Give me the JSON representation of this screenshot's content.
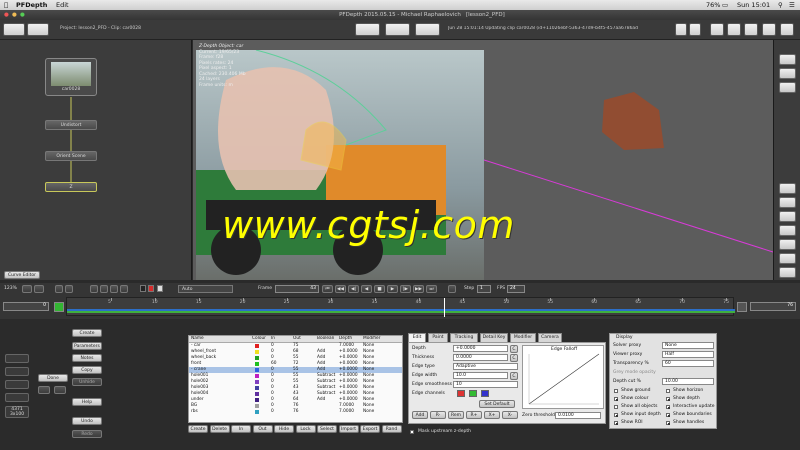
{
  "menubar": {
    "app": "PFDepth",
    "edit": "Edit",
    "zoom": "76%",
    "clock": "Sun 15:01"
  },
  "titlebar": {
    "title": "PFDepth 2015.05.15 - Michael Raphaelovich",
    "doc": "[lesson2_PFD]"
  },
  "toolbar": {
    "project": "Project: lesson2_PFD - Clip: car0028",
    "status": "Jun 28 15:01:14 Updating clip car0028 (id+11026ebf-5363-47d9-b4f5-457aa6786ad0) ..."
  },
  "nodes": {
    "clip": "car0028",
    "n1": "Undistort",
    "n2": "Orient Scene",
    "n3": "Z"
  },
  "nodepanel": {
    "curve_editor": "Curve Editor"
  },
  "viewport": {
    "title": "Z-Depth Object: car",
    "info": [
      "Current: 19/65/23",
      "Frame: f28",
      "Pixels rates: 24",
      "Pixel aspect: 1",
      "Cached: 230.406 Mb",
      "24 layers",
      "Frame units: m"
    ]
  },
  "watermark": "www.cgtsj.com",
  "timeline": {
    "zoom": "123%",
    "mode": "Auto",
    "frame_label": "Frame",
    "frame": "43",
    "step_label": "Step",
    "step": "1",
    "fps_label": "FPS",
    "fps": "24",
    "start": "0",
    "end": "76",
    "ticks": [
      "5",
      "10",
      "15",
      "20",
      "25",
      "30",
      "35",
      "40",
      "45",
      "50",
      "55",
      "60",
      "65",
      "70",
      "75"
    ],
    "playhead": 0.565
  },
  "leftbuttons": {
    "create": "Create",
    "parameters": "Parameters",
    "notes": "Notes",
    "copy": "Copy",
    "unhide": "Unhide",
    "done": "Done",
    "help": "Help",
    "undo": "Undo",
    "redo": "Redo",
    "counter": "4371",
    "counter2": "3x100"
  },
  "objtable": {
    "headers": [
      "Name",
      "Colour",
      "In",
      "Out",
      "Boolean",
      "Depth",
      "Modifier"
    ],
    "rows": [
      {
        "name": "- car",
        "color": "#e02020",
        "in": "0",
        "out": "75",
        "bool": "",
        "depth": "7.0000",
        "mod": "None"
      },
      {
        "name": "wheel_front",
        "color": "#f0e020",
        "in": "0",
        "out": "68",
        "bool": "Add",
        "depth": "+0.0000",
        "mod": "None"
      },
      {
        "name": "wheel_back",
        "color": "#20a020",
        "in": "0",
        "out": "55",
        "bool": "Add",
        "depth": "+0.0000",
        "mod": "None"
      },
      {
        "name": "front",
        "color": "#20c020",
        "in": "60",
        "out": "72",
        "bool": "Add",
        "depth": "+0.0000",
        "mod": "None"
      },
      {
        "name": "- crane",
        "color": "#3060e0",
        "in": "0",
        "out": "55",
        "bool": "Add",
        "depth": "+0.0000",
        "mod": "None"
      },
      {
        "name": "hole001",
        "color": "#c020c0",
        "in": "0",
        "out": "55",
        "bool": "Subtract",
        "depth": "+0.0000",
        "mod": "None"
      },
      {
        "name": "hole002",
        "color": "#8040c0",
        "in": "0",
        "out": "55",
        "bool": "Subtract",
        "depth": "+0.0000",
        "mod": "None"
      },
      {
        "name": "hole003",
        "color": "#4040a0",
        "in": "0",
        "out": "43",
        "bool": "Subtract",
        "depth": "+0.0000",
        "mod": "None"
      },
      {
        "name": "hole004",
        "color": "#6030a0",
        "in": "0",
        "out": "43",
        "bool": "Subtract",
        "depth": "+0.0000",
        "mod": "None"
      },
      {
        "name": "under",
        "color": "#402080",
        "in": "0",
        "out": "64",
        "bool": "Add",
        "depth": "+0.0000",
        "mod": "None"
      },
      {
        "name": "BG",
        "color": "#a0a0a0",
        "in": "0",
        "out": "76",
        "bool": "",
        "depth": "7.0000",
        "mod": "None"
      },
      {
        "name": "rbs",
        "color": "#30a0c0",
        "in": "0",
        "out": "76",
        "bool": "",
        "depth": "7.0000",
        "mod": "None"
      }
    ],
    "buttons": [
      "Create",
      "Delete",
      "In",
      "Out",
      "Hide",
      "Lock",
      "Select",
      "Import",
      "Export",
      "Rand"
    ]
  },
  "tabs": [
    "Edit",
    "Paint",
    "Tracking",
    "Detail Key",
    "Modifier",
    "Camera"
  ],
  "edit": {
    "depth_label": "Depth",
    "depth": "+0.0000",
    "thickness_label": "Thickness",
    "thickness": "0.0000",
    "edge_type_label": "Edge type",
    "edge_type": "Adaptive",
    "edge_width_label": "Edge width",
    "edge_width": "10.0",
    "edge_smooth_label": "Edge smoothness %",
    "edge_smooth": "10",
    "edge_channels_label": "Edge channels",
    "falloff_title": "Edge Falloff",
    "zero_label": "Zero threshold",
    "zero": "0.0100",
    "mask_label": "Mask upstream z-depth",
    "cbtn": "C",
    "setbtn": "Set",
    "setdefault": "Set Default",
    "sm": [
      "Add",
      "R-",
      "Rem",
      "R+",
      "X+",
      "X-"
    ]
  },
  "display": {
    "title": "Display",
    "solver_label": "Solver proxy",
    "solver": "None",
    "viewer_label": "Viewer proxy",
    "viewer": "Half",
    "transp_label": "Transparency %",
    "transp": "60",
    "colour_label": "Grey mode opacity",
    "depth_label": "Depth cut %",
    "depth": "10.00",
    "checks": [
      {
        "l": "Show ground",
        "on": false
      },
      {
        "l": "Show horizon",
        "on": false
      },
      {
        "l": "Show colour",
        "on": true
      },
      {
        "l": "Show depth",
        "on": true
      },
      {
        "l": "Show all objects",
        "on": false
      },
      {
        "l": "Interactive update",
        "on": true
      },
      {
        "l": "Show input depth",
        "on": true
      },
      {
        "l": "Show boundaries",
        "on": true
      },
      {
        "l": "Show ROI",
        "on": true
      },
      {
        "l": "Show handles",
        "on": true
      }
    ]
  }
}
